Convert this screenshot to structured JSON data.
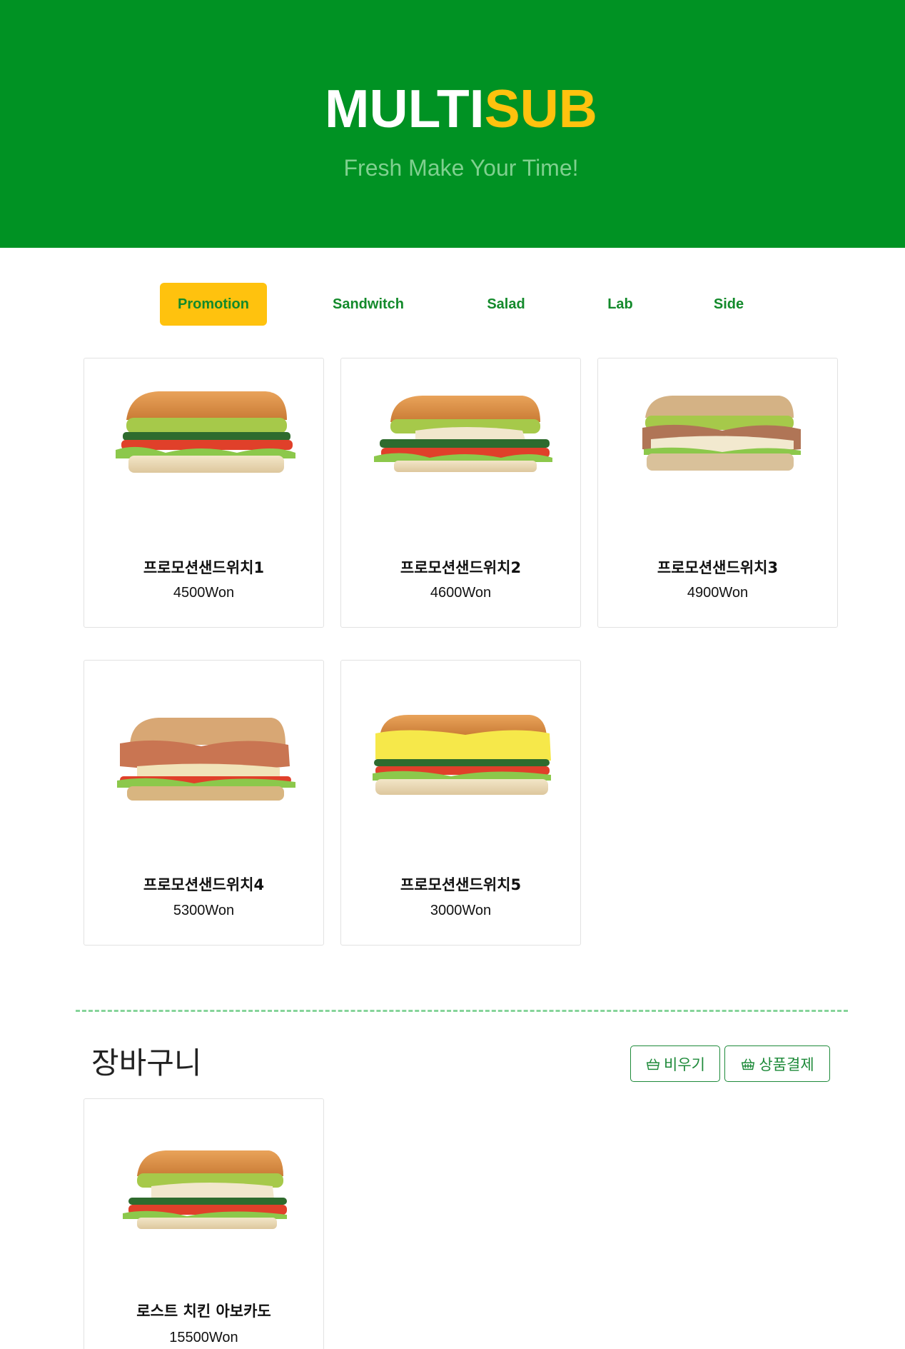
{
  "brand": {
    "part1": "MULTI",
    "part2": "SUB",
    "tagline": "Fresh Make Your Time!"
  },
  "tabs": [
    {
      "label": "Promotion",
      "active": true
    },
    {
      "label": "Sandwitch",
      "active": false
    },
    {
      "label": "Salad",
      "active": false
    },
    {
      "label": "Lab",
      "active": false
    },
    {
      "label": "Side",
      "active": false
    }
  ],
  "products": [
    {
      "name": "프로모션샌드위치1",
      "price": "4500Won",
      "image": "sandwich-avocado-veggie"
    },
    {
      "name": "프로모션샌드위치2",
      "price": "4600Won",
      "image": "sandwich-chicken-avocado"
    },
    {
      "name": "프로모션샌드위치3",
      "price": "4900Won",
      "image": "sandwich-turkey-avocado"
    },
    {
      "name": "프로모션샌드위치4",
      "price": "5300Won",
      "image": "sandwich-pulled-chicken"
    },
    {
      "name": "프로모션샌드위치5",
      "price": "3000Won",
      "image": "sandwich-egg-mayo"
    }
  ],
  "cart": {
    "title": "장바구니",
    "clear_label": "비우기",
    "checkout_label": "상품결제",
    "items": [
      {
        "name": "로스트 치킨 아보카도",
        "price": "15500Won",
        "image": "sandwich-roast-chicken-avocado"
      }
    ]
  },
  "colors": {
    "brand_green": "#009223",
    "brand_yellow": "#ffc20e",
    "accent_green": "#138a2b"
  }
}
